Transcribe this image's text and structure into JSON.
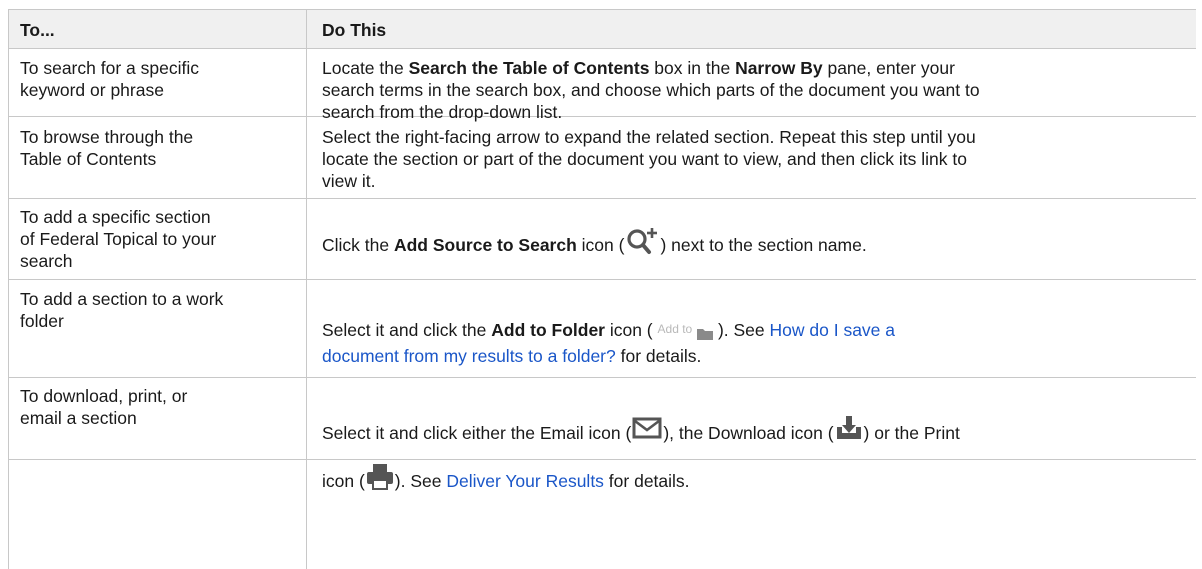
{
  "header": {
    "col1": "To...",
    "col2": "Do This"
  },
  "rows": {
    "r1": {
      "to_lines": [
        "To search for a specific",
        "keyword or phrase"
      ],
      "d1": "Locate the ",
      "d1b": "Search the Table of Contents",
      "d1c": " box in the ",
      "d1d": "Narrow By",
      "d1e": " pane, enter your",
      "d2": "search terms in the search box, and choose which parts of the document you want to",
      "d3": "search from the drop-down list."
    },
    "r2": {
      "to_lines": [
        "To browse through the",
        "Table of Contents"
      ],
      "d1": "Select the right-facing arrow to expand the related section. Repeat this step until you",
      "d2": "locate the section or part of the document you want to view, and then click its link to",
      "d3": "view it."
    },
    "r3": {
      "to_lines": [
        "To add a specific section",
        "of Federal Topical to your",
        "search"
      ],
      "a": "Click the ",
      "b": "Add Source to Search",
      "c": " icon (",
      "d": ") next to the section name."
    },
    "r4": {
      "to_lines": [
        "To add a section to a work",
        "folder"
      ],
      "a": "Select it and click the ",
      "b": "Add to Folder",
      "c": " icon ( ",
      "chip": "Add to",
      "d": " ). See ",
      "link1": "How do I save a",
      "link2": "document from my results to a folder?",
      "e": " for details."
    },
    "r5": {
      "to_lines": [
        "To download, print, or",
        "email a section"
      ],
      "a": "Select it and click either the Email icon (",
      "b": "), the Download icon (",
      "c": ") or the Print",
      "d": "icon (",
      "e": "). See ",
      "link": "Deliver Your Results",
      "f": " for details."
    }
  },
  "icons": {
    "add_source": "add-source-to-search-icon",
    "folder": "folder-icon",
    "email": "email-icon",
    "download": "download-icon",
    "print": "print-icon"
  }
}
